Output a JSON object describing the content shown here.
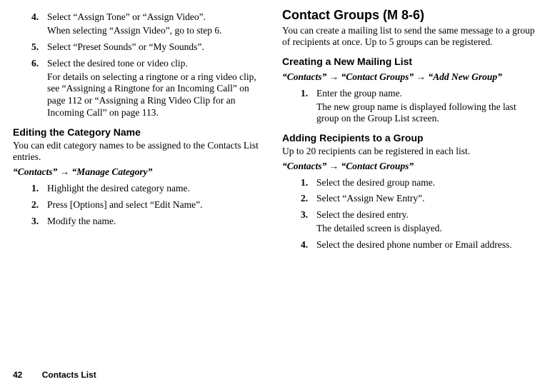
{
  "left": {
    "items_a": [
      {
        "n": "4.",
        "t": "Select “Assign Tone” or “Assign Video”."
      }
    ],
    "sub_a": "When selecting “Assign Video”, go to step 6.",
    "items_b": [
      {
        "n": "5.",
        "t": "Select “Preset Sounds” or “My Sounds”."
      },
      {
        "n": "6.",
        "t": "Select the desired tone or video clip."
      }
    ],
    "sub_b": "For details on selecting a ringtone or a ring video clip, see “Assigning a Ringtone for an Incoming Call” on page 112 or “Assigning a Ring Video Clip for an Incoming Call” on page 113.",
    "edit_h": "Editing the Category Name",
    "edit_p": "You can edit category names to be assigned to the Contacts List entries.",
    "edit_path_a": "“Contacts”",
    "edit_path_b": "“Manage Category”",
    "edit_steps": [
      {
        "n": "1.",
        "t": "Highlight the desired category name."
      },
      {
        "n": "2.",
        "t": "Press [Options] and select “Edit Name”."
      },
      {
        "n": "3.",
        "t": "Modify the name."
      }
    ]
  },
  "right": {
    "title": "Contact Groups",
    "menu": " (M 8-6)",
    "intro": "You can create a mailing list to send the same message to a group of recipients at once. Up to 5 groups can be registered.",
    "create_h": "Creating a New Mailing List",
    "create_path_a": "“Contacts”",
    "create_path_b": "“Contact Groups”",
    "create_path_c": "“Add New Group”",
    "create_steps": [
      {
        "n": "1.",
        "t": "Enter the group name."
      }
    ],
    "create_sub": "The new group name is displayed following the last group on the Group List screen.",
    "add_h": "Adding Recipients to a Group",
    "add_p": "Up to 20 recipients can be registered in each list.",
    "add_path_a": "“Contacts”",
    "add_path_b": "“Contact Groups”",
    "add_steps_a": [
      {
        "n": "1.",
        "t": "Select the desired group name."
      },
      {
        "n": "2.",
        "t": "Select “Assign New Entry”."
      },
      {
        "n": "3.",
        "t": "Select the desired entry."
      }
    ],
    "add_sub": "The detailed screen is displayed.",
    "add_steps_b": [
      {
        "n": "4.",
        "t": "Select the desired phone number or Email address."
      }
    ]
  },
  "footer": {
    "page": "42",
    "section": "Contacts List"
  },
  "arrow": "→"
}
